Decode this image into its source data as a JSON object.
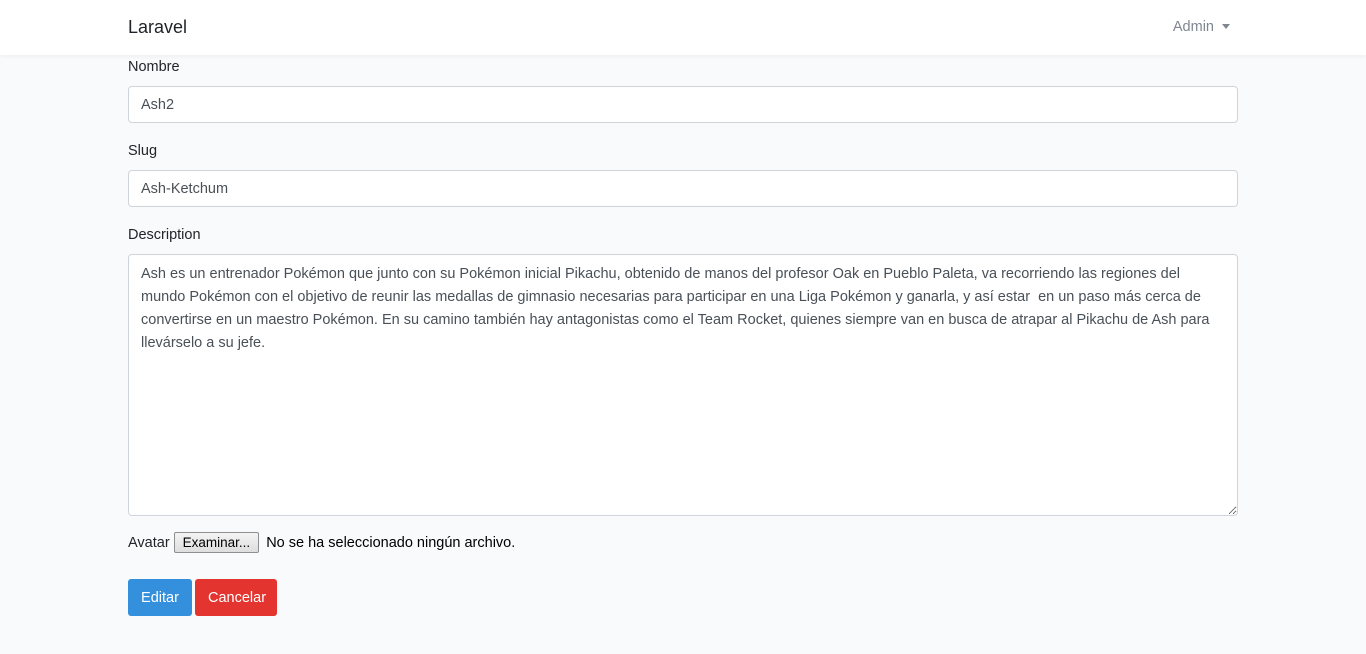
{
  "navbar": {
    "brand": "Laravel",
    "user_menu_label": "Admin"
  },
  "form": {
    "name_label": "Nombre",
    "name_value": "Ash2",
    "slug_label": "Slug",
    "slug_value": "Ash-Ketchum",
    "description_label": "Description",
    "description_value": "Ash es un entrenador Pokémon que junto con su Pokémon inicial Pikachu, obtenido de manos del profesor Oak en Pueblo Paleta, va recorriendo las regiones del mundo Pokémon con el objetivo de reunir las medallas de gimnasio necesarias para participar en una Liga Pokémon y ganarla, y así estar  en un paso más cerca de convertirse en un maestro Pokémon. En su camino también hay antagonistas como el Team Rocket, quienes siempre van en busca de atrapar al Pikachu de Ash para llevárselo a su jefe.",
    "avatar_label": "Avatar",
    "file_button_label": "Examinar...",
    "file_status": "No se ha seleccionado ningún archivo.",
    "submit_label": "Editar",
    "cancel_label": "Cancelar"
  },
  "colors": {
    "primary": "#3490dc",
    "danger": "#e3342f",
    "background": "#f8fafc"
  }
}
